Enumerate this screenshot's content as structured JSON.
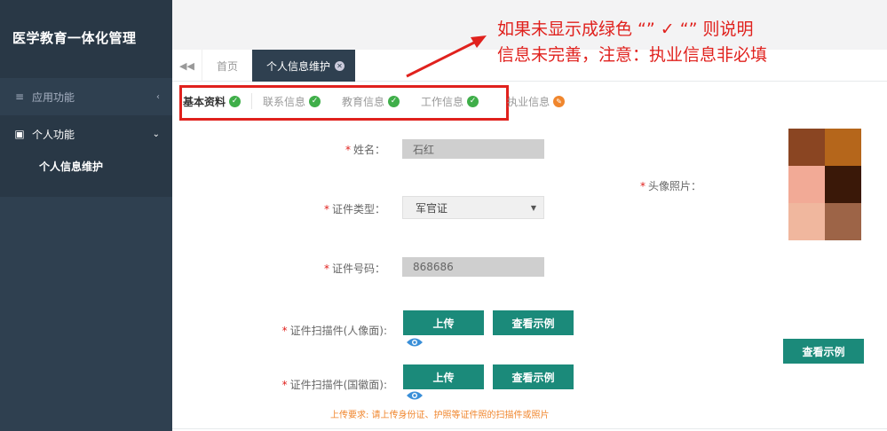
{
  "sidebar": {
    "brand": "医学教育一体化管理",
    "items": [
      {
        "icon": "menu-icon",
        "label": "应用功能",
        "chevron": "‹"
      },
      {
        "icon": "id-card-icon",
        "label": "个人功能",
        "chevron": "⌄"
      }
    ],
    "sub_items": [
      "个人信息维护"
    ]
  },
  "tabs": {
    "items": [
      "首页",
      "个人信息维护"
    ]
  },
  "annotation": {
    "line1": "如果未显示成绿色 “” ✓ “” 则说明",
    "line2": "信息未完善，注意：执业信息非必填"
  },
  "subtabs": [
    {
      "label": "基本资料",
      "status": "complete"
    },
    {
      "label": "联系信息",
      "status": "complete"
    },
    {
      "label": "教育信息",
      "status": "complete"
    },
    {
      "label": "工作信息",
      "status": "complete"
    },
    {
      "label": "执业信息",
      "status": "incomplete"
    }
  ],
  "form": {
    "name_label": "姓名：",
    "name_value": "石红",
    "id_type_label": "证件类型：",
    "id_type_value": "军官证",
    "id_number_label": "证件号码：",
    "id_number_value": "868686",
    "scan_front_label": "证件扫描件(人像面):",
    "scan_back_label": "证件扫描件(国徽面):",
    "upload_label": "上传",
    "example_label": "查看示例",
    "upload_note": "上传要求: 请上传身份证、护照等证件照的扫描件或照片",
    "photo_label": "头像照片：",
    "photo_example_label": "查看示例"
  },
  "colors": {
    "sidebar": "#2f4050",
    "accent_green": "#1b8a7a",
    "check_green": "#3fae49",
    "warn_orange": "#f0862d",
    "annotation_red": "#e0211d"
  }
}
